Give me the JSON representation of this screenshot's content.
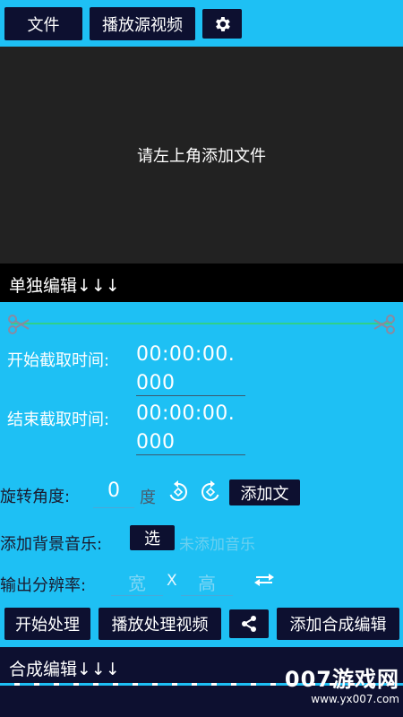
{
  "toolbar": {
    "file_label": "文件",
    "play_source_label": "播放源视频"
  },
  "preview": {
    "hint": "请左上角添加文件"
  },
  "single_edit": {
    "title": "单独编辑↓↓↓"
  },
  "trim": {
    "start_label": "开始截取时间:",
    "start_value_line1": "00:00:00.",
    "start_value_line2": "000",
    "end_label": "结束截取时间:",
    "end_value_line1": "00:00:00.",
    "end_value_line2": "000"
  },
  "rotate": {
    "label": "旋转角度:",
    "value": "0",
    "unit": "度",
    "add_text_label": "添加文"
  },
  "music": {
    "label": "添加背景音乐:",
    "select_label": "选",
    "status": "未添加音乐"
  },
  "resolution": {
    "label": "输出分辨率:",
    "width_placeholder": "宽",
    "separator": "X",
    "height_placeholder": "高"
  },
  "actions": {
    "process_label": "开始处理",
    "play_processed_label": "播放处理视频",
    "merge_edit_label": "添加合成编辑"
  },
  "merge_section": {
    "title": "合成编辑↓↓↓"
  },
  "watermark": {
    "main": "007游戏网",
    "url": "www.yx007.com"
  }
}
